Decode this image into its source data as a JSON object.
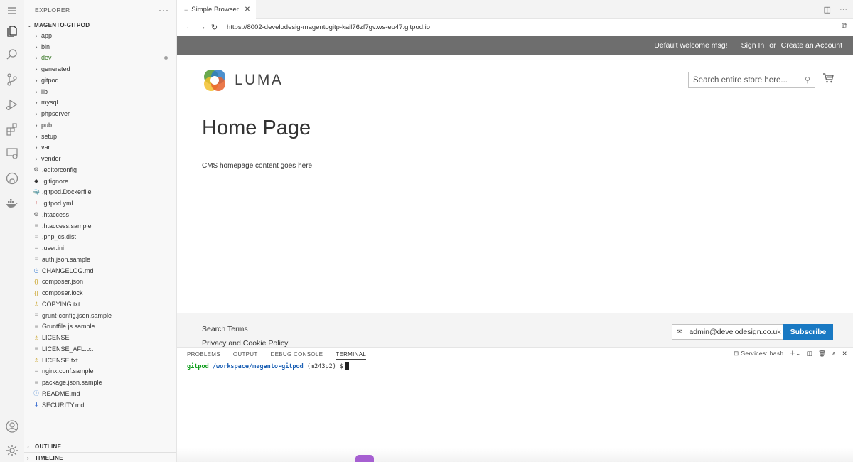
{
  "activity_bar": {
    "icons": [
      "menu-icon",
      "files-icon",
      "search-icon",
      "source-control-icon",
      "run-debug-icon",
      "extensions-icon",
      "remote-explorer-icon",
      "github-icon",
      "docker-icon",
      "account-icon",
      "settings-gear-icon"
    ]
  },
  "explorer": {
    "header": "EXPLORER",
    "more": "···",
    "root": "MAGENTO-GITPOD",
    "folders": [
      {
        "name": "app"
      },
      {
        "name": "bin"
      },
      {
        "name": "dev"
      },
      {
        "name": "generated"
      },
      {
        "name": "gitpod"
      },
      {
        "name": "lib"
      },
      {
        "name": "mysql"
      },
      {
        "name": "phpserver"
      },
      {
        "name": "pub"
      },
      {
        "name": "setup"
      },
      {
        "name": "var"
      },
      {
        "name": "vendor"
      }
    ],
    "files": [
      {
        "name": ".editorconfig",
        "icon": "⚙",
        "color": "#555555"
      },
      {
        "name": ".gitignore",
        "icon": "◆",
        "color": "#333333"
      },
      {
        "name": ".gitpod.Dockerfile",
        "icon": "🐳",
        "color": "#3d8fd1"
      },
      {
        "name": ".gitpod.yml",
        "icon": "!",
        "color": "#c23a3a"
      },
      {
        "name": ".htaccess",
        "icon": "⚙",
        "color": "#555555"
      },
      {
        "name": ".htaccess.sample",
        "icon": "≡",
        "color": "#999999"
      },
      {
        "name": ".php_cs.dist",
        "icon": "≡",
        "color": "#999999"
      },
      {
        "name": ".user.ini",
        "icon": "≡",
        "color": "#999999"
      },
      {
        "name": "auth.json.sample",
        "icon": "≡",
        "color": "#999999"
      },
      {
        "name": "CHANGELOG.md",
        "icon": "◷",
        "color": "#3d7fd1"
      },
      {
        "name": "composer.json",
        "icon": "{}",
        "color": "#c9a227"
      },
      {
        "name": "composer.lock",
        "icon": "{}",
        "color": "#c9a227"
      },
      {
        "name": "COPYING.txt",
        "icon": "♗",
        "color": "#c9a227"
      },
      {
        "name": "grunt-config.json.sample",
        "icon": "≡",
        "color": "#999999"
      },
      {
        "name": "Gruntfile.js.sample",
        "icon": "≡",
        "color": "#999999"
      },
      {
        "name": "LICENSE",
        "icon": "♗",
        "color": "#c9a227"
      },
      {
        "name": "LICENSE_AFL.txt",
        "icon": "≡",
        "color": "#999999"
      },
      {
        "name": "LICENSE.txt",
        "icon": "♗",
        "color": "#c9a227"
      },
      {
        "name": "nginx.conf.sample",
        "icon": "≡",
        "color": "#999999"
      },
      {
        "name": "package.json.sample",
        "icon": "≡",
        "color": "#999999"
      },
      {
        "name": "README.md",
        "icon": "ⓘ",
        "color": "#3d7fd1"
      },
      {
        "name": "SECURITY.md",
        "icon": "⬇",
        "color": "#3d6fd1"
      }
    ],
    "outline": "OUTLINE",
    "timeline": "TIMELINE"
  },
  "editor": {
    "tab_label": "Simple Browser",
    "tab_icon": "≡",
    "close": "✕",
    "url": "https://8002-develodesig-magentogitp-kail76zf7gv.ws-eu47.gitpod.io"
  },
  "luma": {
    "welcome": "Default welcome msg!",
    "sign_in": "Sign In",
    "or": "or",
    "create_account": "Create an Account",
    "logo_text": "LUMA",
    "search_placeholder": "Search entire store here...",
    "page_title": "Home Page",
    "content": "CMS homepage content goes here.",
    "footer_links": [
      "Search Terms",
      "Privacy and Cookie Policy"
    ],
    "newsletter_email": "admin@develodesign.co.uk",
    "subscribe": "Subscribe"
  },
  "panel": {
    "tabs": [
      "PROBLEMS",
      "OUTPUT",
      "DEBUG CONSOLE",
      "TERMINAL"
    ],
    "active_tab": "TERMINAL",
    "services": "Services: bash",
    "terminal": {
      "user": "gitpod",
      "path": "/workspace/magento-gitpod",
      "branch": "(m243p2)",
      "prompt": "$"
    }
  },
  "colors": {
    "luma_top_bar": "#6e6e6e",
    "subscribe_button": "#1979c3",
    "terminal_user": "#0f9d1c",
    "terminal_path": "#1a5fb4"
  }
}
